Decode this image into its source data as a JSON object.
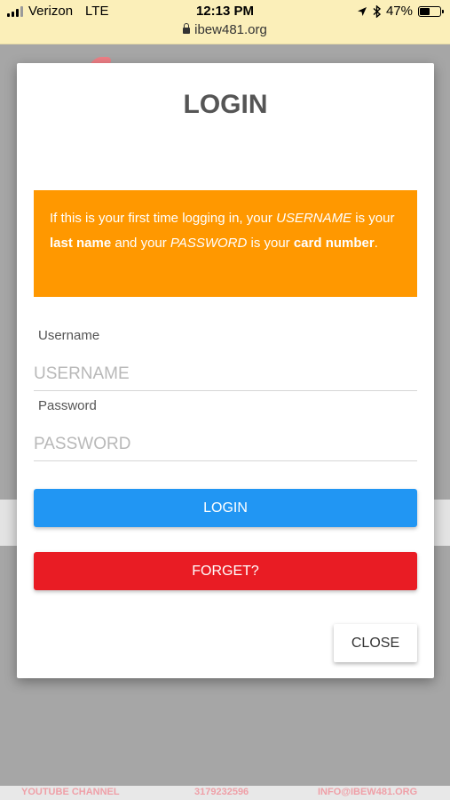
{
  "status_bar": {
    "carrier": "Verizon",
    "network": "LTE",
    "time": "12:13 PM",
    "battery": "47%",
    "battery_level": 0.47
  },
  "browser": {
    "url": "ibew481.org"
  },
  "background_footer": {
    "youtube": "YOUTUBE CHANNEL",
    "phone": "3179232596",
    "email": "INFO@IBEW481.ORG"
  },
  "modal": {
    "title": "LOGIN",
    "notice": {
      "p1": "If this is your first time logging in, your ",
      "username_em": "USERNAME",
      "p2": " is your ",
      "last_name_b": "last name",
      "p3": " and your ",
      "password_em": "PASSWORD",
      "p4": " is your ",
      "card_number_b": "card number",
      "p5": "."
    },
    "username": {
      "label": "Username",
      "placeholder": "USERNAME",
      "value": ""
    },
    "password": {
      "label": "Password",
      "placeholder": "PASSWORD",
      "value": ""
    },
    "login_button": "LOGIN",
    "forget_button": "FORGET?",
    "close_button": "CLOSE"
  },
  "colors": {
    "notice_bg": "#ff9800",
    "login_btn": "#2196f3",
    "forget_btn": "#e91c24"
  }
}
